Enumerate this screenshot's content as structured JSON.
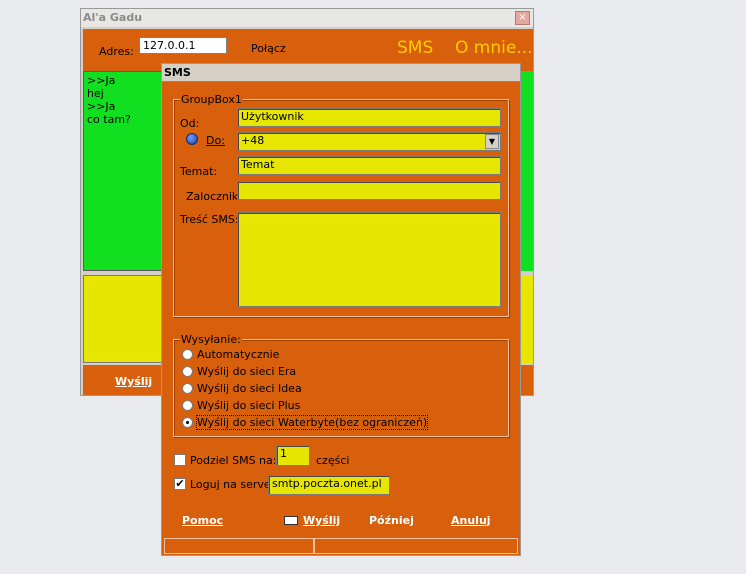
{
  "main_window": {
    "title": "Al'a Gadu",
    "close": "×",
    "address_label": "Adres:",
    "address_value": "127.0.0.1",
    "connect_label": "Połącz",
    "sms_label": "SMS",
    "about_label": "O mnie...",
    "chat_lines": [
      ">>Ja",
      "hej",
      ">>Ja",
      "co tam?"
    ],
    "send_label": "Wyślij"
  },
  "sms_dialog": {
    "title": "SMS",
    "group1_legend": "GroupBox1",
    "from_label": "Od:",
    "from_value": "Użytkownik",
    "to_label": "Do:",
    "to_value": "+48",
    "subject_label": "Temat:",
    "subject_value": "Temat",
    "attachment_label": "Zalocznik",
    "attachment_value": "",
    "body_label": "Treść SMS:",
    "body_value": "",
    "send_group_legend": "Wysyłanie:",
    "send_options": [
      "Automatycznie",
      "Wyślij do sieci Era",
      "Wyślij do sieci Idea",
      "Wyślij do sieci Plus",
      "Wyślij do sieci Waterbyte(bez ograniczeń)"
    ],
    "selected_option": 4,
    "split_label": "Podziel SMS na:",
    "split_value": "1",
    "split_unit": "części",
    "split_checked": false,
    "login_label": "Loguj na server",
    "login_checked": true,
    "server_value": "smtp.poczta.onet.pl",
    "help_label": "Pomoc",
    "send_label": "Wyślij",
    "later_label": "Później",
    "cancel_label": "Anuluj"
  },
  "colors": {
    "orange": "#d8600c",
    "green": "#10e020",
    "yellow": "#e6e600",
    "accent_text": "#ffcc00"
  }
}
